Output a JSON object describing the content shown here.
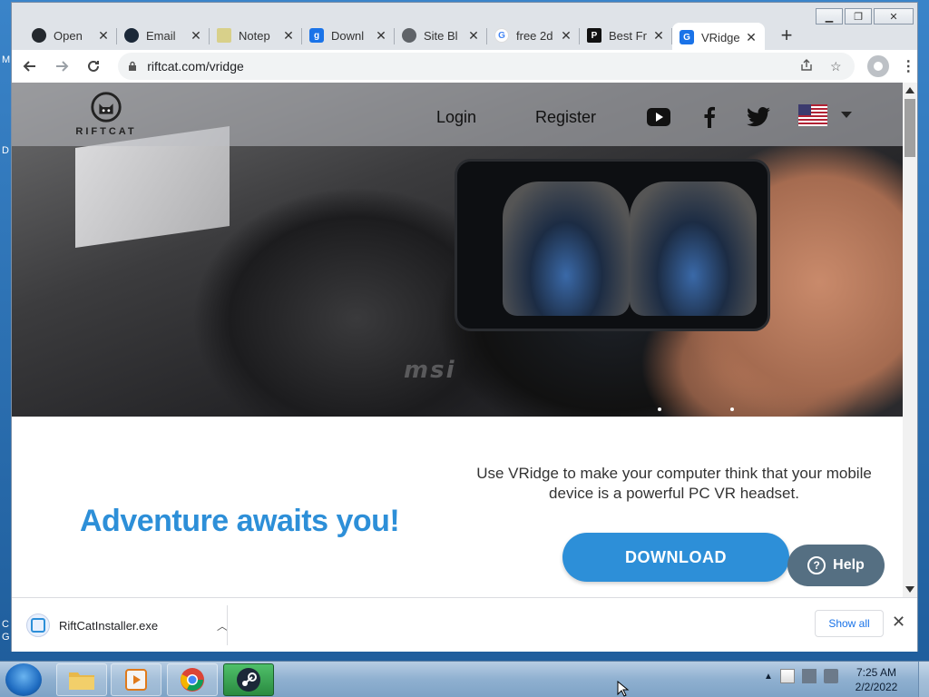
{
  "window": {
    "controls": {
      "minimize": "▁",
      "maximize": "❐",
      "close": "✕"
    }
  },
  "tabs": [
    {
      "title": "Open",
      "icon": "github-icon",
      "color": "#24292e",
      "glyph": ""
    },
    {
      "title": "Email",
      "icon": "steam-icon",
      "color": "#1b2838",
      "glyph": ""
    },
    {
      "title": "Notep",
      "icon": "notepad-icon",
      "color": "#d8d08a",
      "glyph": ""
    },
    {
      "title": "Downl",
      "icon": "download-icon",
      "color": "#1a73e8",
      "glyph": "g"
    },
    {
      "title": "Site Bl",
      "icon": "globe-icon",
      "color": "#5f6368",
      "glyph": ""
    },
    {
      "title": "free 2d",
      "icon": "google-icon",
      "color": "#ffffff",
      "glyph": "G"
    },
    {
      "title": "Best Fr",
      "icon": "pcgamer-icon",
      "color": "#111111",
      "glyph": "P"
    },
    {
      "title": "VRidge",
      "icon": "riftcat-icon",
      "color": "#1a73e8",
      "glyph": "G",
      "active": true
    }
  ],
  "address": {
    "url": "riftcat.com/vridge"
  },
  "site": {
    "logo_text": "RIFTCAT",
    "nav": {
      "login": "Login",
      "register": "Register"
    },
    "hero_brand": "msi",
    "headline": "Adventure awaits you!",
    "tagline": "Use VRidge to make your computer think that your mobile device is a powerful PC VR headset.",
    "download_label": "DOWNLOAD",
    "help_label": "Help",
    "accent_color": "#2d8fd8"
  },
  "download_shelf": {
    "filename": "RiftCatInstaller.exe",
    "show_all": "Show all"
  },
  "taskbar": {
    "time": "7:25 AM",
    "date": "2/2/2022"
  },
  "desktop": {
    "left_edge_letters": [
      "M",
      "D",
      "C",
      "G"
    ]
  }
}
